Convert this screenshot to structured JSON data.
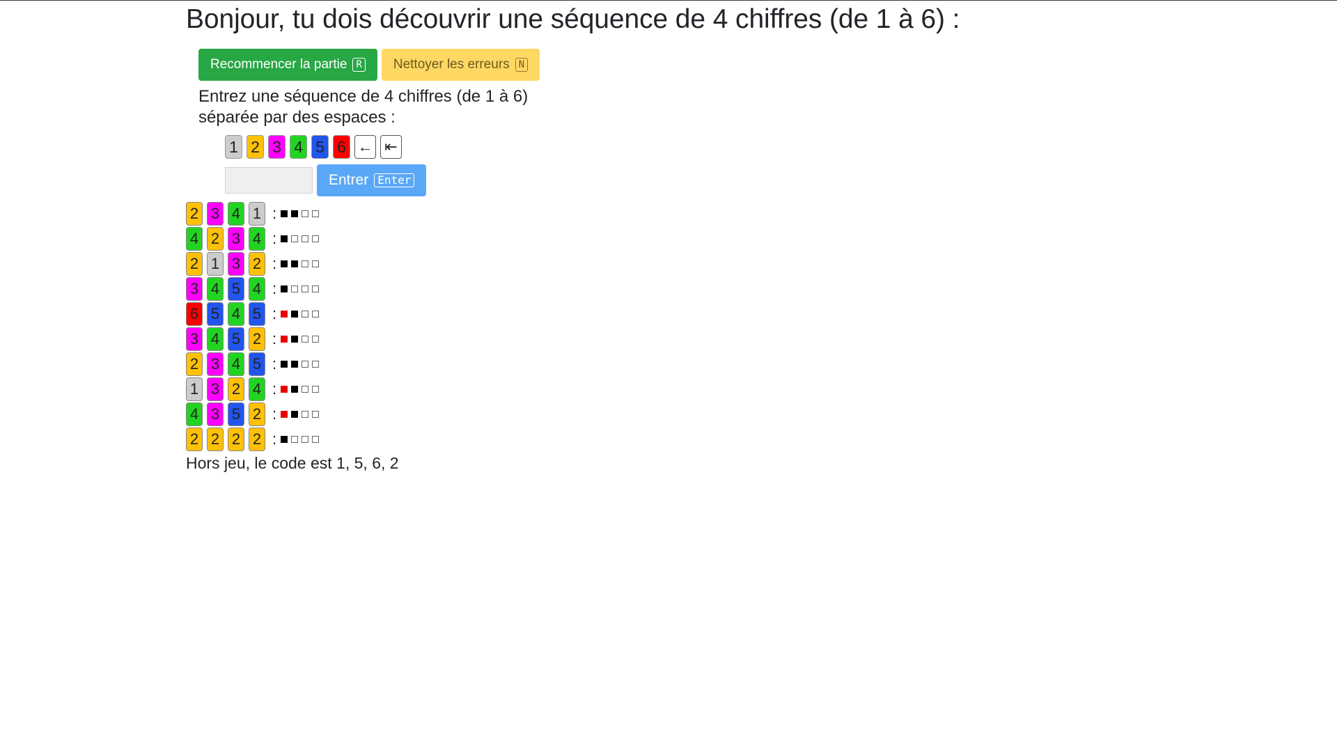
{
  "header": {
    "title": "Bonjour, tu dois découvrir une séquence de 4 chiffres (de 1 à 6) :"
  },
  "actions": {
    "restart_label": "Recommencer la partie",
    "restart_key": "R",
    "clear_label": "Nettoyer les erreurs",
    "clear_key": "N"
  },
  "instructions": "Entrez une séquence de 4 chiffres (de 1 à 6) séparée par des espaces :",
  "palette": [
    {
      "label": "1",
      "color": "#cccccc"
    },
    {
      "label": "2",
      "color": "#ffc107"
    },
    {
      "label": "3",
      "color": "#ff00ff"
    },
    {
      "label": "4",
      "color": "#22d422"
    },
    {
      "label": "5",
      "color": "#2255ee"
    },
    {
      "label": "6",
      "color": "#ff0000"
    }
  ],
  "palette_icons": {
    "backspace": "←",
    "clear": "⇤"
  },
  "entry": {
    "value": "",
    "submit_label": "Entrer",
    "submit_key": "Enter"
  },
  "history": [
    {
      "guess": [
        "2",
        "3",
        "4",
        "1"
      ],
      "feedback": [
        "black",
        "black",
        "empty",
        "empty"
      ]
    },
    {
      "guess": [
        "4",
        "2",
        "3",
        "4"
      ],
      "feedback": [
        "black",
        "empty",
        "empty",
        "empty"
      ]
    },
    {
      "guess": [
        "2",
        "1",
        "3",
        "2"
      ],
      "feedback": [
        "black",
        "black",
        "empty",
        "empty"
      ]
    },
    {
      "guess": [
        "3",
        "4",
        "5",
        "4"
      ],
      "feedback": [
        "black",
        "empty",
        "empty",
        "empty"
      ]
    },
    {
      "guess": [
        "6",
        "5",
        "4",
        "5"
      ],
      "feedback": [
        "red",
        "black",
        "empty",
        "empty"
      ]
    },
    {
      "guess": [
        "3",
        "4",
        "5",
        "2"
      ],
      "feedback": [
        "red",
        "black",
        "empty",
        "empty"
      ]
    },
    {
      "guess": [
        "2",
        "3",
        "4",
        "5"
      ],
      "feedback": [
        "black",
        "black",
        "empty",
        "empty"
      ]
    },
    {
      "guess": [
        "1",
        "3",
        "2",
        "4"
      ],
      "feedback": [
        "red",
        "black",
        "empty",
        "empty"
      ]
    },
    {
      "guess": [
        "4",
        "3",
        "5",
        "2"
      ],
      "feedback": [
        "red",
        "black",
        "empty",
        "empty"
      ]
    },
    {
      "guess": [
        "2",
        "2",
        "2",
        "2"
      ],
      "feedback": [
        "black",
        "empty",
        "empty",
        "empty"
      ]
    }
  ],
  "result_text": "Hors jeu, le code est 1, 5, 6, 2"
}
